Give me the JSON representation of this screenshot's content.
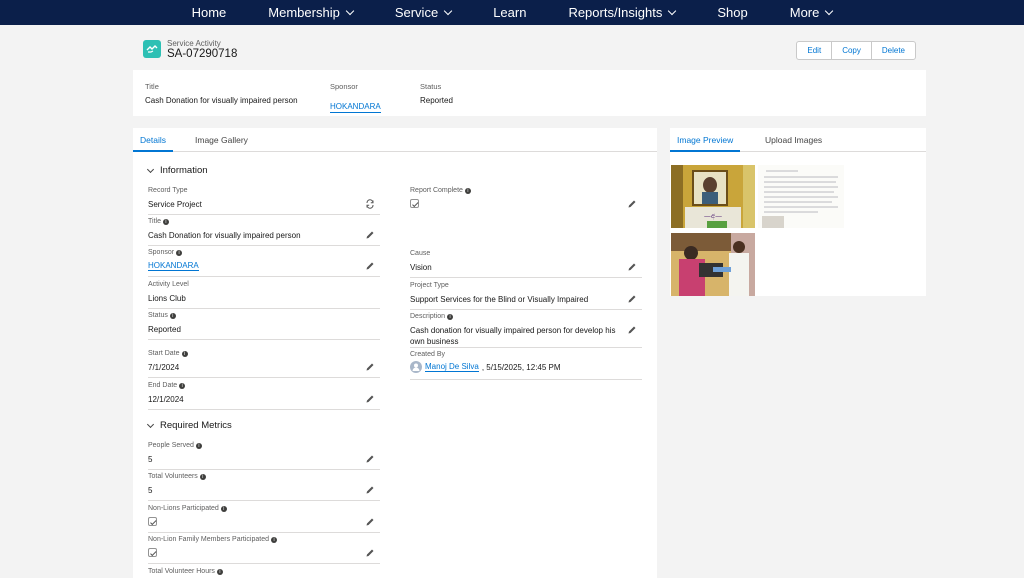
{
  "nav": {
    "items": [
      {
        "label": "Home",
        "dropdown": false
      },
      {
        "label": "Membership",
        "dropdown": true
      },
      {
        "label": "Service",
        "dropdown": true
      },
      {
        "label": "Learn",
        "dropdown": false
      },
      {
        "label": "Reports/Insights",
        "dropdown": true
      },
      {
        "label": "Shop",
        "dropdown": false
      },
      {
        "label": "More",
        "dropdown": true
      }
    ]
  },
  "record": {
    "type_label": "Service Activity",
    "name": "SA-07290718",
    "actions": {
      "edit": "Edit",
      "copy": "Copy",
      "delete": "Delete"
    }
  },
  "highlights": {
    "title_label": "Title",
    "title_value": "Cash Donation for visually impaired person",
    "sponsor_label": "Sponsor",
    "sponsor_value": "HOKANDARA",
    "status_label": "Status",
    "status_value": "Reported"
  },
  "tabs": {
    "details": "Details",
    "gallery": "Image Gallery"
  },
  "sections": {
    "information": "Information",
    "metrics": "Required Metrics"
  },
  "fields": {
    "record_type": {
      "label": "Record Type",
      "value": "Service Project"
    },
    "title": {
      "label": "Title",
      "value": "Cash Donation for visually impaired person"
    },
    "sponsor": {
      "label": "Sponsor",
      "value": "HOKANDARA"
    },
    "activity_level": {
      "label": "Activity Level",
      "value": "Lions Club"
    },
    "status": {
      "label": "Status",
      "value": "Reported"
    },
    "start_date": {
      "label": "Start Date",
      "value": "7/1/2024"
    },
    "end_date": {
      "label": "End Date",
      "value": "12/1/2024"
    },
    "report_complete": {
      "label": "Report Complete",
      "checked": true
    },
    "cause": {
      "label": "Cause",
      "value": "Vision"
    },
    "project_type": {
      "label": "Project Type",
      "value": "Support Services for the Blind or Visually Impaired"
    },
    "description": {
      "label": "Description",
      "value": "Cash donation for visually impaired person for develop his own business"
    },
    "created_by": {
      "label": "Created By",
      "user": "Manoj De Silva",
      "date": ", 5/15/2025, 12:45 PM"
    }
  },
  "metrics": {
    "people_served": {
      "label": "People Served",
      "value": "5"
    },
    "total_volunteers": {
      "label": "Total Volunteers",
      "value": "5"
    },
    "non_lions": {
      "label": "Non-Lions Participated",
      "checked": true
    },
    "non_lion_family": {
      "label": "Non-Lion Family Members Participated",
      "checked": true
    },
    "volunteer_hours": {
      "label": "Total Volunteer Hours"
    }
  },
  "side_tabs": {
    "preview": "Image Preview",
    "upload": "Upload Images"
  },
  "colors": {
    "nav_bg": "#0b1f4a",
    "accent": "#0176d3",
    "record_icon": "#2dc0b4"
  }
}
